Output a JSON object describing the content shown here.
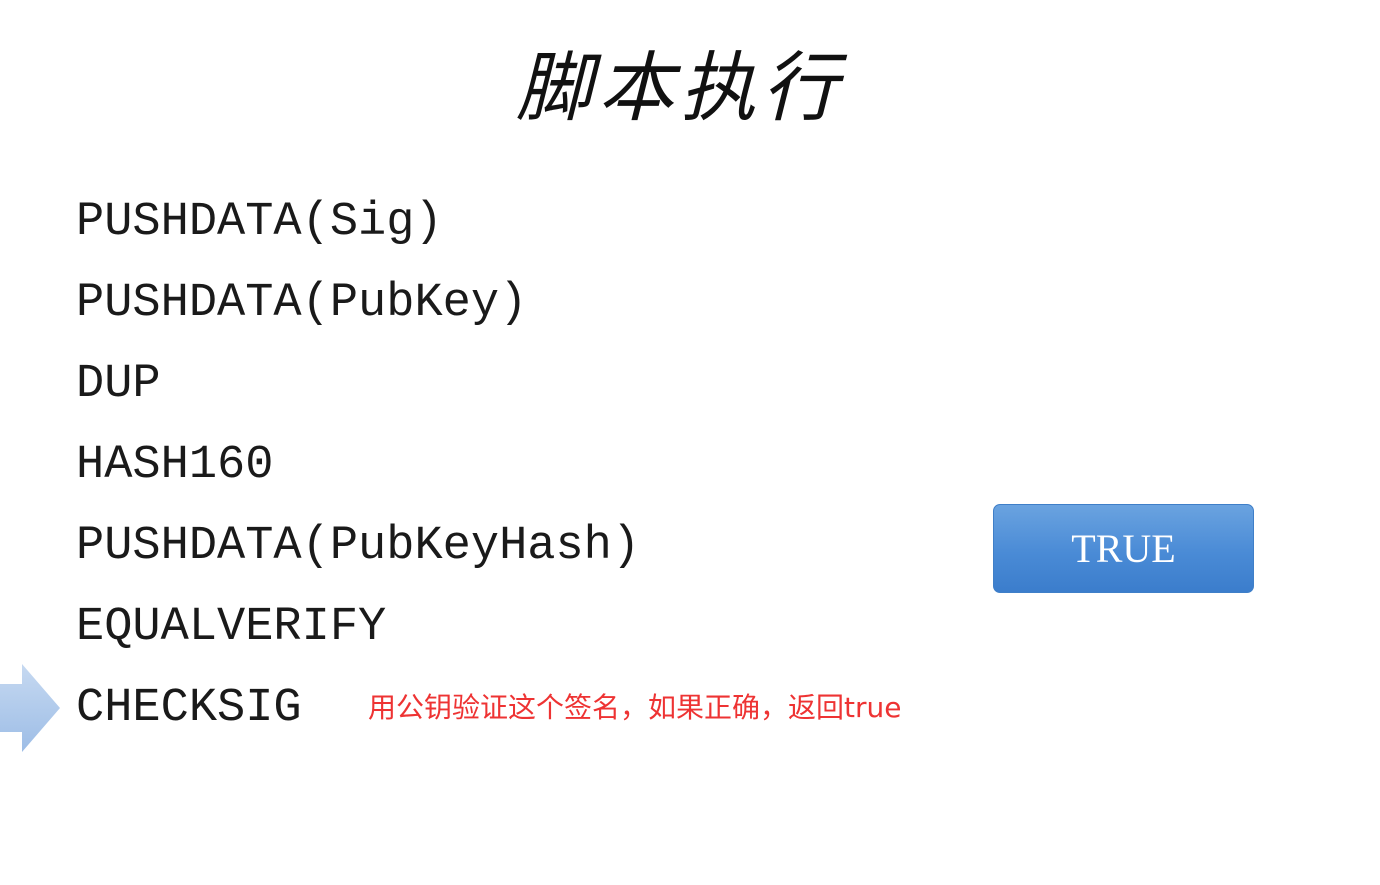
{
  "slide": {
    "title": "脚本执行",
    "ops": [
      "PUSHDATA(Sig)",
      "PUSHDATA(PubKey)",
      "DUP",
      "HASH160",
      "PUSHDATA(PubKeyHash)",
      "EQUALVERIFY",
      "CHECKSIG"
    ],
    "current_op_index": 6,
    "current_op_note": "用公钥验证这个签名，如果正确，返回true",
    "stack_result": "TRUE"
  },
  "colors": {
    "note": "#ee3333",
    "result_box": "#4a8bd6",
    "arrow": "#a9c6ea"
  },
  "icons": {
    "pointer": "right-arrow-icon"
  }
}
